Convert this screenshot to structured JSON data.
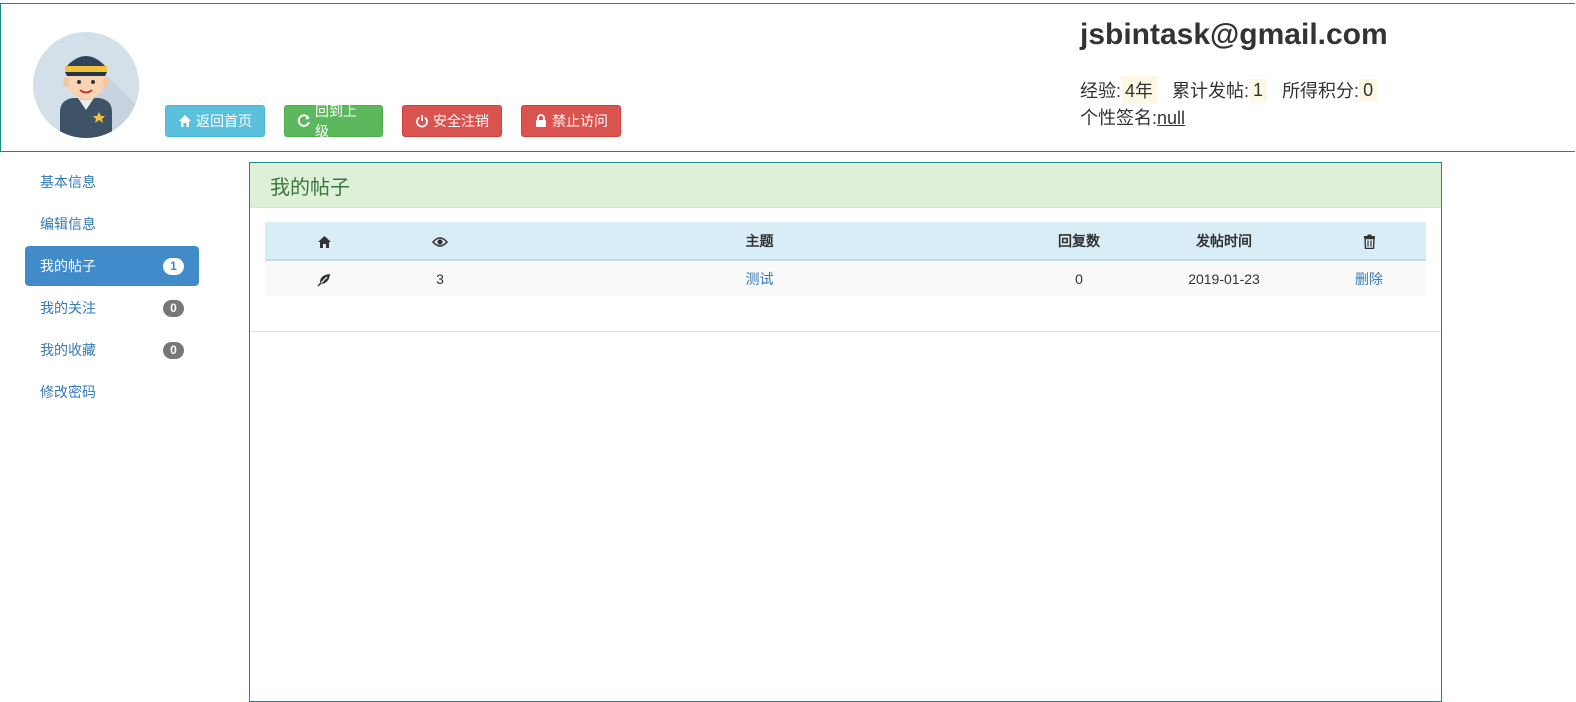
{
  "header": {
    "email": "jsbintask@gmail.com",
    "stats": {
      "experience_label": "经验:",
      "experience_value": "4年",
      "posts_label": "累计发帖:",
      "posts_value": "1",
      "points_label": "所得积分:",
      "points_value": "0"
    },
    "signature_label": "个性签名:",
    "signature_value": "null",
    "buttons": {
      "home": "返回首页",
      "back": "回到上级",
      "logout": "安全注销",
      "forbid": "禁止访问"
    }
  },
  "sidebar": {
    "items": [
      {
        "label": "基本信息"
      },
      {
        "label": "编辑信息"
      },
      {
        "label": "我的帖子",
        "badge": "1"
      },
      {
        "label": "我的关注",
        "badge": "0"
      },
      {
        "label": "我的收藏",
        "badge": "0"
      },
      {
        "label": "修改密码"
      }
    ]
  },
  "panel": {
    "title": "我的帖子",
    "table": {
      "headers": {
        "home_icon": "home-icon",
        "views_icon": "eye-icon",
        "subject": "主题",
        "replies": "回复数",
        "post_time": "发帖时间",
        "delete_icon": "trash-icon"
      },
      "rows": [
        {
          "type_icon": "leaf-icon",
          "views": "3",
          "subject": "测试",
          "replies": "0",
          "post_time": "2019-01-23",
          "action": "删除"
        }
      ]
    }
  },
  "colors": {
    "accent_border": "#1a8a83",
    "primary": "#428bca",
    "info": "#5bc0de",
    "success": "#5cb85c",
    "danger": "#d9534f"
  }
}
